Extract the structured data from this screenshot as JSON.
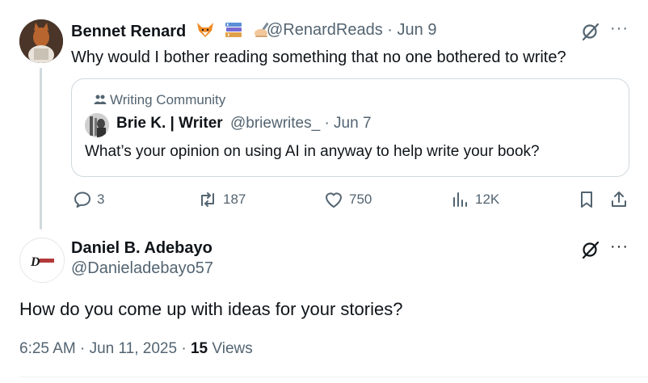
{
  "reply_tweet": {
    "author_name": "Bennet Renard",
    "emojis": [
      "fox-emoji",
      "books-emoji",
      "writing-hand-emoji"
    ],
    "handle": "@RenardReads",
    "separator": "·",
    "date": "Jun 9",
    "text": "Why would I bother reading something that no one bothered to write?",
    "quote": {
      "community": "Writing Community",
      "author_name": "Brie K. | Writer",
      "handle": "@briewrites_",
      "separator": "·",
      "date": "Jun 7",
      "text": "What’s your opinion on using AI in anyway to help write your book?"
    },
    "actions": {
      "replies": "3",
      "reposts": "187",
      "likes": "750",
      "views": "12K"
    }
  },
  "main_tweet": {
    "author_name": "Daniel B. Adebayo",
    "handle": "@Danieladebayo57",
    "avatar_text": "D",
    "text": "How do you come up with ideas for your stories?",
    "time": "6:25 AM",
    "separator1": "·",
    "date": "Jun 11, 2025",
    "separator2": "·",
    "views_count": "15",
    "views_label": "Views"
  },
  "menu_label": "···",
  "colors": {
    "muted": "#536471",
    "text": "#0f1419",
    "border": "#cfd9de"
  }
}
